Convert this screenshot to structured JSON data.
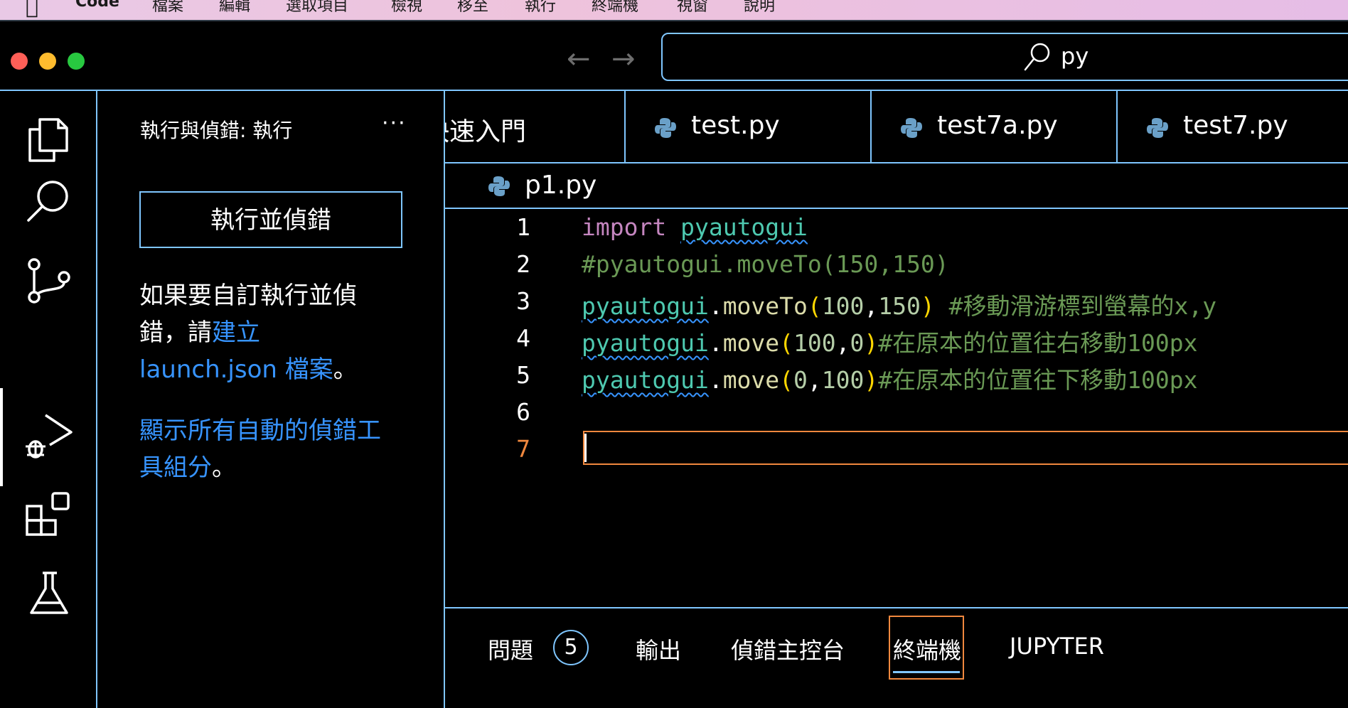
{
  "menubar": {
    "app": "Code",
    "items": [
      "檔案",
      "編輯",
      "選取項目",
      "檢視",
      "移至",
      "執行",
      "終端機",
      "視窗",
      "說明"
    ]
  },
  "titlebar": {
    "traffic_lights": {
      "close": "#ff5f57",
      "minimize": "#febc2e",
      "maximize": "#28c840"
    },
    "search_text": "py"
  },
  "activity_bar": {
    "items": [
      {
        "name": "explorer",
        "icon": "files-icon"
      },
      {
        "name": "search",
        "icon": "search-icon"
      },
      {
        "name": "source-control",
        "icon": "source-control-icon"
      },
      {
        "name": "run-and-debug",
        "icon": "run-debug-icon",
        "active": true
      },
      {
        "name": "extensions",
        "icon": "extensions-icon"
      },
      {
        "name": "testing",
        "icon": "flask-icon"
      }
    ]
  },
  "sidebar": {
    "title": "執行與偵錯: 執行",
    "more": "···",
    "run_button": "執行並偵錯",
    "para1_text": "如果要自訂執行並偵錯，請",
    "para1_link": "建立 launch.json 檔案",
    "para1_end": "。",
    "para2_link": "顯示所有自動的偵錯工具組分",
    "para2_end": "。"
  },
  "tabs": [
    {
      "label": "快速入門",
      "icon": false
    },
    {
      "label": "test.py",
      "icon": true
    },
    {
      "label": "test7a.py",
      "icon": true
    },
    {
      "label": "test7.py",
      "icon": true
    }
  ],
  "breadcrumb": {
    "file": "p1.py"
  },
  "editor": {
    "line_numbers": [
      "1",
      "2",
      "3",
      "4",
      "5",
      "6",
      "7"
    ],
    "active_line": "7",
    "lines": {
      "l1": {
        "kw": "import",
        "mod": "pyautogui"
      },
      "l2": {
        "comment": "#pyautogui.moveTo(150,150)"
      },
      "l3": {
        "mod": "pyautogui",
        "dot": ".",
        "fn": "moveTo",
        "open": "(",
        "a": "100",
        "sep": ",",
        "b": "150",
        "close": ")",
        "comment": " #移動滑游標到螢幕的x,y"
      },
      "l4": {
        "mod": "pyautogui",
        "dot": ".",
        "fn": "move",
        "open": "(",
        "a": "100",
        "sep": ",",
        "b": "0",
        "close": ")",
        "comment": "#在原本的位置往右移動100px"
      },
      "l5": {
        "mod": "pyautogui",
        "dot": ".",
        "fn": "move",
        "open": "(",
        "a": "0",
        "sep": ",",
        "b": "100",
        "close": ")",
        "comment": "#在原本的位置往下移動100px"
      }
    }
  },
  "panel": {
    "tabs": {
      "problems": "問題",
      "problems_count": "5",
      "output": "輸出",
      "debug_console": "偵錯主控台",
      "terminal": "終端機",
      "jupyter": "JUPYTER"
    },
    "active": "終端機"
  }
}
